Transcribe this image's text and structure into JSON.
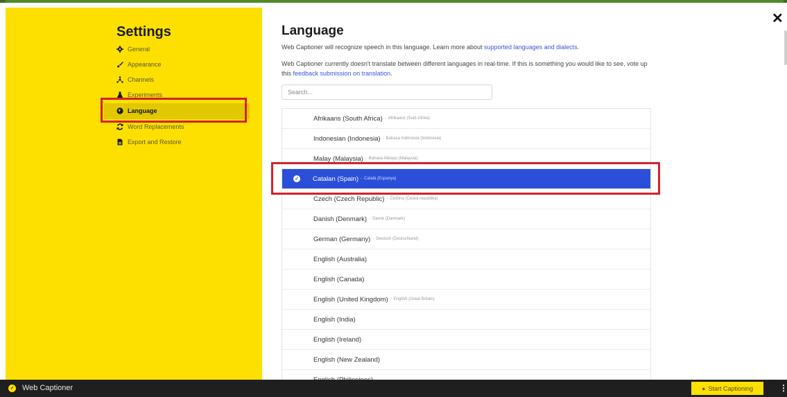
{
  "settings": {
    "title": "Settings",
    "nav": [
      {
        "label": "General",
        "icon": "gear-icon"
      },
      {
        "label": "Appearance",
        "icon": "brush-icon"
      },
      {
        "label": "Channels",
        "icon": "channels-icon"
      },
      {
        "label": "Experiments",
        "icon": "flask-icon"
      },
      {
        "label": "Language",
        "icon": "globe-icon"
      },
      {
        "label": "Word Replacements",
        "icon": "refresh-icon"
      },
      {
        "label": "Export and Restore",
        "icon": "file-icon"
      }
    ],
    "active": "Language"
  },
  "main": {
    "title": "Language",
    "desc1_text": "Web Captioner will recognize speech in this language. Learn more about ",
    "desc1_link": "supported languages and dialects",
    "desc1_end": ".",
    "desc2_text": "Web Captioner currently doesn't translate between different languages in real-time. If this is something you would like to see, vote up this ",
    "desc2_link": "feedback submission on translation",
    "desc2_end": ".",
    "search_placeholder": "Search...",
    "languages": [
      {
        "name": "Afrikaans (South Africa)",
        "native": "Afrikaans (Suid-Afrika)"
      },
      {
        "name": "Indonesian (Indonesia)",
        "native": "Bahasa Indonesia (Indonesia)"
      },
      {
        "name": "Malay (Malaysia)",
        "native": "Bahasa Melayu (Malaysia)"
      },
      {
        "name": "Catalan (Spain)",
        "native": "Català (Espanya)",
        "selected": true
      },
      {
        "name": "Czech (Czech Republic)",
        "native": "Čeština (Česká republika)"
      },
      {
        "name": "Danish (Denmark)",
        "native": "Dansk (Danmark)"
      },
      {
        "name": "German (Germany)",
        "native": "Deutsch (Deutschland)"
      },
      {
        "name": "English (Australia)",
        "native": ""
      },
      {
        "name": "English (Canada)",
        "native": ""
      },
      {
        "name": "English (United Kingdom)",
        "native": "English (Great Britain)"
      },
      {
        "name": "English (India)",
        "native": ""
      },
      {
        "name": "English (Ireland)",
        "native": ""
      },
      {
        "name": "English (New Zealand)",
        "native": ""
      },
      {
        "name": "English (Philippines)",
        "native": ""
      }
    ]
  },
  "bottombar": {
    "app_name": "Web Captioner",
    "start_label": "Start Captioning"
  },
  "colors": {
    "accent_yellow": "#fde000",
    "selected_blue": "#2b4fd9",
    "highlight_red": "#d4202c"
  }
}
